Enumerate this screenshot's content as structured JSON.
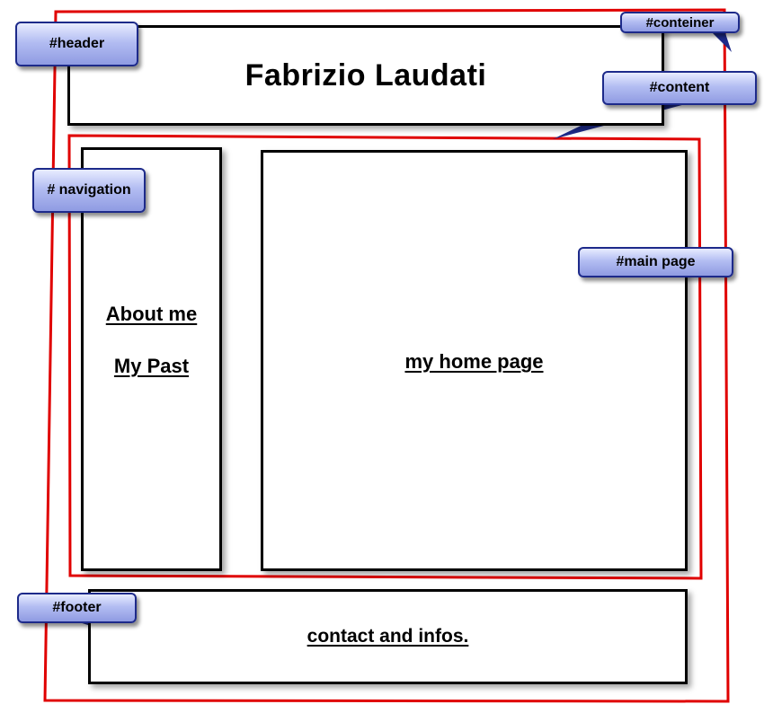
{
  "header": {
    "title": "Fabrizio Laudati"
  },
  "navigation": {
    "items": [
      {
        "label": "About me"
      },
      {
        "label": "My Past"
      }
    ]
  },
  "main_page": {
    "link_label": "my home page"
  },
  "footer": {
    "link_label": "contact and infos."
  },
  "callouts": {
    "header": "#header",
    "container": "#conteiner",
    "content": "#content",
    "navigation": "# navigation",
    "main_page": "#main page",
    "footer": "#footer"
  },
  "colors": {
    "outline_red": "#e00000",
    "box_border": "#000000",
    "callout_border": "#1d2a8a",
    "callout_fill": "#b3bdf2"
  }
}
